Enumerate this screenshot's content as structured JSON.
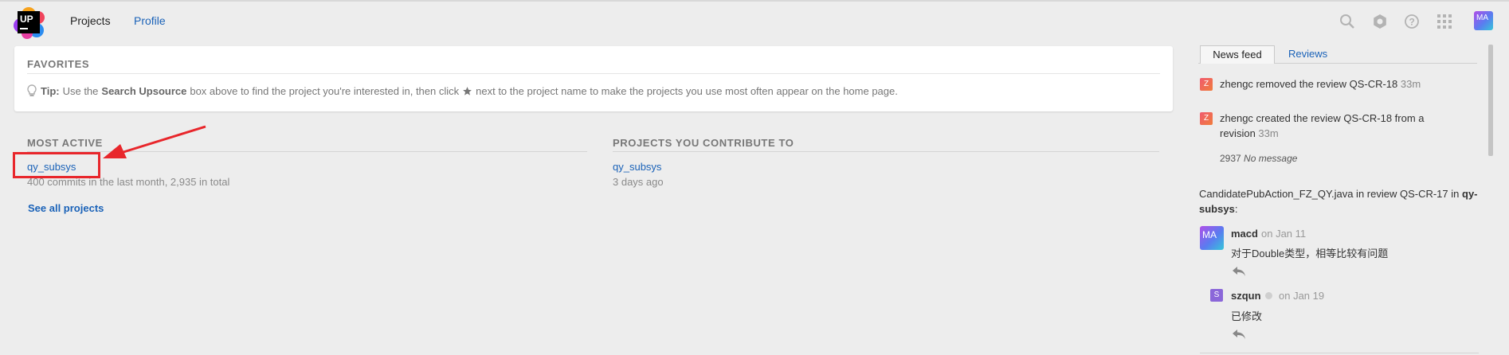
{
  "header": {
    "nav": {
      "projects": "Projects",
      "profile": "Profile"
    },
    "user_initials": "MA",
    "icons": [
      "search-icon",
      "settings-icon",
      "help-icon",
      "apps-grid-icon"
    ]
  },
  "favorites": {
    "title": "FAVORITES",
    "tip_label": "Tip:",
    "tip_pre": "Use the",
    "tip_strong": "Search Upsource",
    "tip_mid": "box above to find the project you're interested in, then click",
    "tip_post": "next to the project name to make the projects you use most often appear on the home page."
  },
  "most_active": {
    "title": "MOST ACTIVE",
    "project": "qy_subsys",
    "meta": "400 commits in the last month, 2,935 in total",
    "see_all": "See all projects"
  },
  "contribute": {
    "title": "PROJECTS YOU CONTRIBUTE TO",
    "project": "qy_subsys",
    "meta": "3 days ago"
  },
  "feed": {
    "tabs": {
      "news": "News feed",
      "reviews": "Reviews"
    },
    "items": [
      {
        "avatar": "Z",
        "text": "zhengc removed the review QS-CR-18",
        "time": "33m"
      },
      {
        "avatar": "Z",
        "text_line1": "zhengc created the review QS-CR-18 from a",
        "text_line2": "revision",
        "time": "33m",
        "revision": "2937",
        "revision_msg": "No message"
      }
    ],
    "discussion": {
      "file": "CandidatePubAction_FZ_QY.java in review QS-CR-17 in",
      "project_bold": "qy-subsys",
      "project_suffix": ":",
      "comments": [
        {
          "avatar": "MA",
          "author": "macd",
          "date": "on Jan 11",
          "body": "对于Double类型，相等比较有问题"
        },
        {
          "avatar": "S",
          "author": "szqun",
          "date": "on Jan 19",
          "body": "已修改"
        }
      ]
    }
  },
  "colors": {
    "link": "#1a62b8",
    "highlight": "#e8262b",
    "background": "#ededed"
  }
}
